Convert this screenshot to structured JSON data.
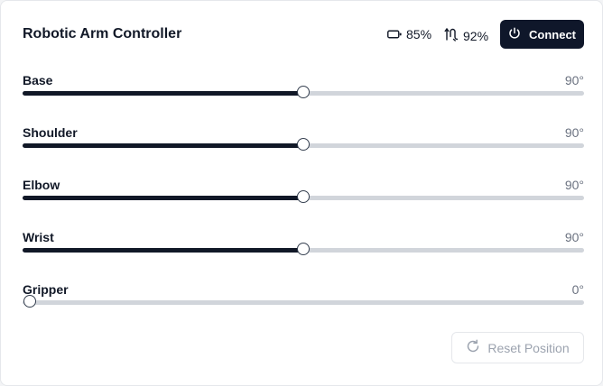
{
  "header": {
    "title": "Robotic Arm Controller",
    "battery_text": "85%",
    "battery_icon": "battery-icon",
    "signal_text": "92%",
    "signal_icon": "signal-icon",
    "connect_label": "Connect",
    "connect_icon": "power-icon"
  },
  "joints": [
    {
      "label": "Base",
      "value_text": "90°",
      "degrees": 90
    },
    {
      "label": "Shoulder",
      "value_text": "90°",
      "degrees": 90
    },
    {
      "label": "Elbow",
      "value_text": "90°",
      "degrees": 90
    },
    {
      "label": "Wrist",
      "value_text": "90°",
      "degrees": 90
    },
    {
      "label": "Gripper",
      "value_text": "0°",
      "degrees": 0
    }
  ],
  "slider_range": {
    "min": 0,
    "max": 180
  },
  "reset": {
    "label": "Reset Position",
    "icon": "reset-icon",
    "enabled": false
  },
  "colors": {
    "primary": "#0f172a",
    "track": "#d1d5db",
    "fill": "#111827",
    "muted_text": "#6b7280"
  }
}
